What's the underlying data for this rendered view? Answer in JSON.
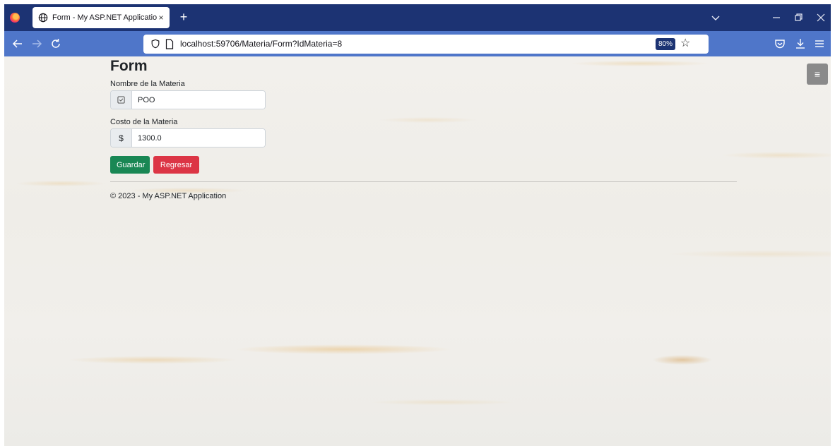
{
  "browser": {
    "tab_title": "Form - My ASP.NET Application",
    "tab_close": "×",
    "new_tab": "+",
    "url": "localhost:59706/Materia/Form?IdMateria=8",
    "zoom": "80%"
  },
  "page": {
    "title": "Form",
    "fields": [
      {
        "label": "Nombre de la Materia",
        "value": "POO",
        "addon_icon": "check-square-icon"
      },
      {
        "label": "Costo de la Materia",
        "value": "1300.0",
        "addon_text": "$"
      }
    ],
    "buttons": {
      "save_label": "Guardar",
      "back_label": "Regresar"
    },
    "footer": "© 2023 - My ASP.NET Application"
  },
  "colors": {
    "tabstrip": "#1c3373",
    "navbar": "#4f76c9",
    "success": "#198754",
    "danger": "#dc3545"
  }
}
